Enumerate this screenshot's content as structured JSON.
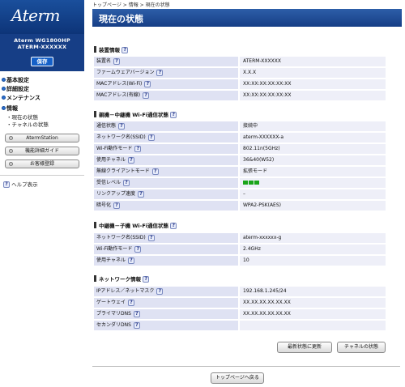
{
  "sidebar": {
    "logo": "Aterm",
    "model": "Aterm WG1800HP",
    "device_id": "ATERM-XXXXXX",
    "save_label": "保存",
    "menu": [
      {
        "label": "基本設定"
      },
      {
        "label": "詳細設定"
      },
      {
        "label": "メンテナンス"
      },
      {
        "label": "情報"
      }
    ],
    "submenu": [
      "現在の状態",
      "チャネルの状態"
    ],
    "buttons": [
      "AtermStation",
      "機能詳細ガイド",
      "お客様登録"
    ],
    "help_label": "ヘルプ表示",
    "help_glyph": "?"
  },
  "breadcrumb": "トップページ > 情報 > 現在の状態",
  "page_title": "現在の状態",
  "sections": [
    {
      "title": "装置情報",
      "rows": [
        {
          "key": "装置名",
          "value": "ATERM-XXXXXX"
        },
        {
          "key": "ファームウェアバージョン",
          "value": "X.X.X"
        },
        {
          "key": "MACアドレス(Wi-Fi)",
          "value": "XX:XX:XX:XX:XX:XX"
        },
        {
          "key": "MACアドレス(有線)",
          "value": "XX:XX:XX:XX:XX:XX"
        }
      ]
    },
    {
      "title": "親機－中継機 Wi-Fi通信状態",
      "rows": [
        {
          "key": "通信状態",
          "value": "接続中"
        },
        {
          "key": "ネットワーク名(SSID)",
          "value": "aterm-XXXXXX-a"
        },
        {
          "key": "Wi-Fi動作モード",
          "value": "802.11n(5GHz)"
        },
        {
          "key": "使用チャネル",
          "value": "36&40(W52)"
        },
        {
          "key": "無線クライアントモード",
          "value": "拡張モード"
        },
        {
          "key": "受信レベル",
          "value": "",
          "signal_bars": 3
        },
        {
          "key": "リンクアップ速度",
          "value": "–"
        },
        {
          "key": "暗号化",
          "value": "WPA2-PSK(AES)"
        }
      ]
    },
    {
      "title": "中継機－子機 Wi-Fi通信状態",
      "rows": [
        {
          "key": "ネットワーク名(SSID)",
          "value": "aterm-xxxxxx-g"
        },
        {
          "key": "Wi-Fi動作モード",
          "value": "2.4GHz"
        },
        {
          "key": "使用チャネル",
          "value": "10"
        }
      ]
    },
    {
      "title": "ネットワーク情報",
      "rows": [
        {
          "key": "IPアドレス／ネットマスク",
          "value": "192.168.1.245/24"
        },
        {
          "key": "ゲートウェイ",
          "value": "XX.XX.XX.XX.XX.XX"
        },
        {
          "key": "プライマリDNS",
          "value": "XX.XX.XX.XX.XX.XX"
        },
        {
          "key": "セカンダリDNS",
          "value": ""
        }
      ]
    }
  ],
  "actions": {
    "refresh_label": "最新状態に更新",
    "channel_label": "チャネルの状態",
    "top_label": "トップページへ戻る"
  },
  "colors": {
    "title_bar": "#163e86",
    "key_cell": "#dfe2f3",
    "value_cell": "#eeeff8",
    "signal": "#1aa51a"
  }
}
